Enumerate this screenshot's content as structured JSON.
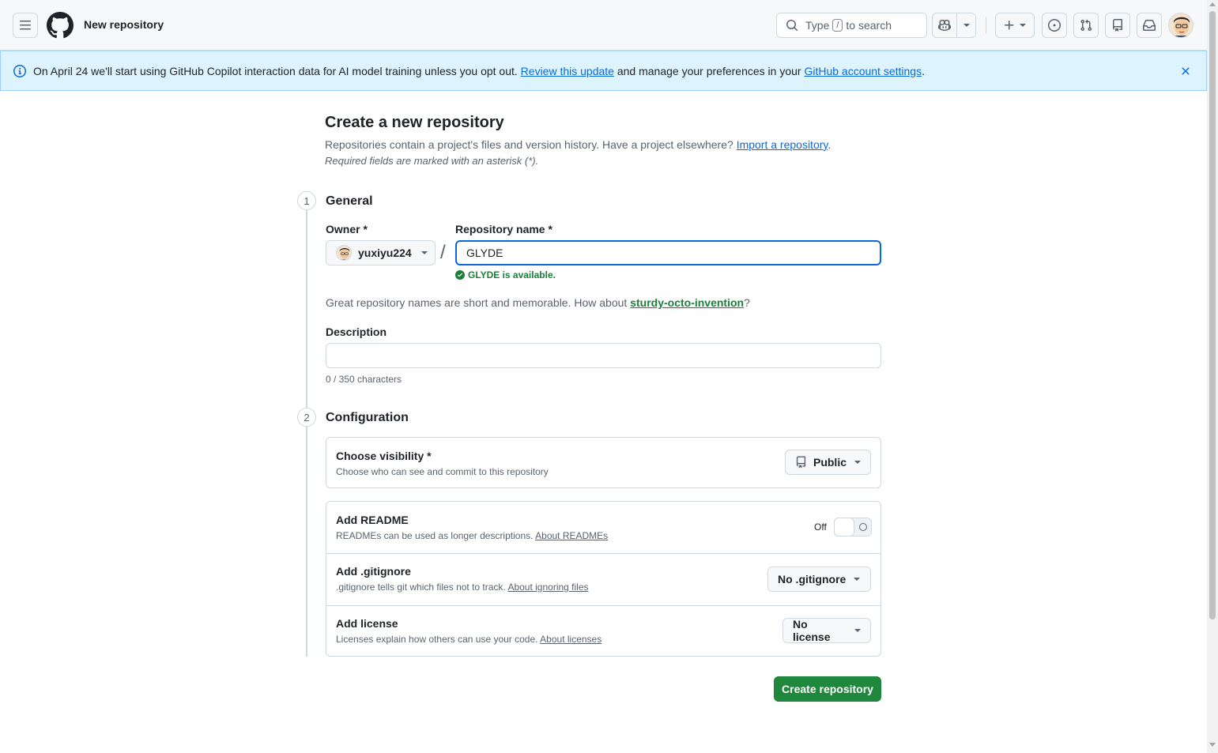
{
  "header": {
    "title": "New repository",
    "search_prefix": "Type",
    "search_key": "/",
    "search_suffix": "to search"
  },
  "banner": {
    "text_before": "On April 24 we'll start using GitHub Copilot interaction data for AI model training unless you opt out.",
    "link1": "Review this update",
    "text_middle": "and manage your preferences in your",
    "link2": "GitHub account settings",
    "text_end": "."
  },
  "page": {
    "title": "Create a new repository",
    "intro": "Repositories contain a project's files and version history. Have a project elsewhere?",
    "import_link": "Import a repository",
    "intro_end": ".",
    "required_note": "Required fields are marked with an asterisk (*)."
  },
  "general": {
    "step": "1",
    "title": "General",
    "owner_label": "Owner *",
    "owner_value": "yuxiyu224",
    "slash": "/",
    "repo_label": "Repository name *",
    "repo_value": "GLYDE",
    "availability": "GLYDE is available.",
    "suggest_text": "Great repository names are short and memorable. How about",
    "suggest_link": "sturdy-octo-invention",
    "suggest_end": "?",
    "description_label": "Description",
    "description_value": "",
    "char_count": "0 / 350 characters"
  },
  "configuration": {
    "step": "2",
    "title": "Configuration",
    "visibility_title": "Choose visibility *",
    "visibility_sub": "Choose who can see and commit to this repository",
    "visibility_value": "Public",
    "readme_title": "Add README",
    "readme_sub": "READMEs can be used as longer descriptions.",
    "readme_link": "About READMEs",
    "readme_toggle": "Off",
    "gitignore_title": "Add .gitignore",
    "gitignore_sub": ".gitignore tells git which files not to track.",
    "gitignore_link": "About ignoring files",
    "gitignore_value": "No .gitignore",
    "license_title": "Add license",
    "license_sub": "Licenses explain how others can use your code.",
    "license_link": "About licenses",
    "license_value": "No license"
  },
  "actions": {
    "create": "Create repository"
  },
  "colors": {
    "primary_button": "#1f883d",
    "link": "#0969da",
    "success": "#1a7f37",
    "banner_bg": "#ddf4ff"
  },
  "icons": [
    "hamburger-icon",
    "github-logo-icon",
    "search-icon",
    "copilot-icon",
    "plus-icon",
    "issues-icon",
    "pull-request-icon",
    "repo-icon",
    "inbox-icon",
    "info-icon",
    "close-icon",
    "check-circle-icon"
  ]
}
